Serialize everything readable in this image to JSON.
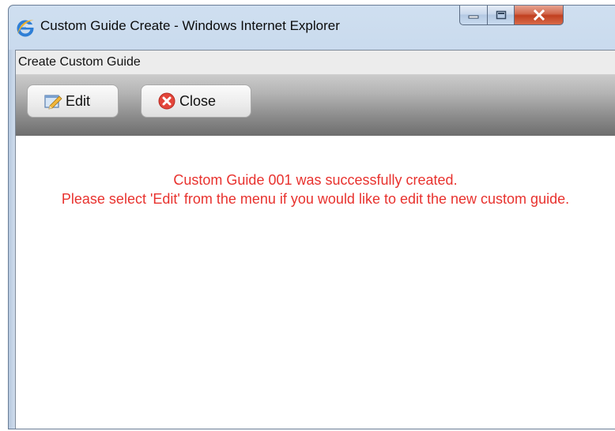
{
  "window": {
    "title": "Custom Guide Create - Windows Internet Explorer",
    "controls": {
      "minimize_icon": "minimize-icon",
      "maximize_icon": "maximize-icon",
      "close_icon": "close-x-icon"
    }
  },
  "page": {
    "header_title": "Create Custom Guide"
  },
  "toolbar": {
    "edit_label": "Edit",
    "close_label": "Close"
  },
  "message": {
    "line1": "Custom Guide 001 was successfully created.",
    "line2": "Please select 'Edit' from the menu if you would like to edit the new custom guide.",
    "color": "#e8322e"
  },
  "colors": {
    "titlebar": "#b9cde6",
    "toolbar": "#8a8a8a",
    "close_button": "#c1401f"
  }
}
